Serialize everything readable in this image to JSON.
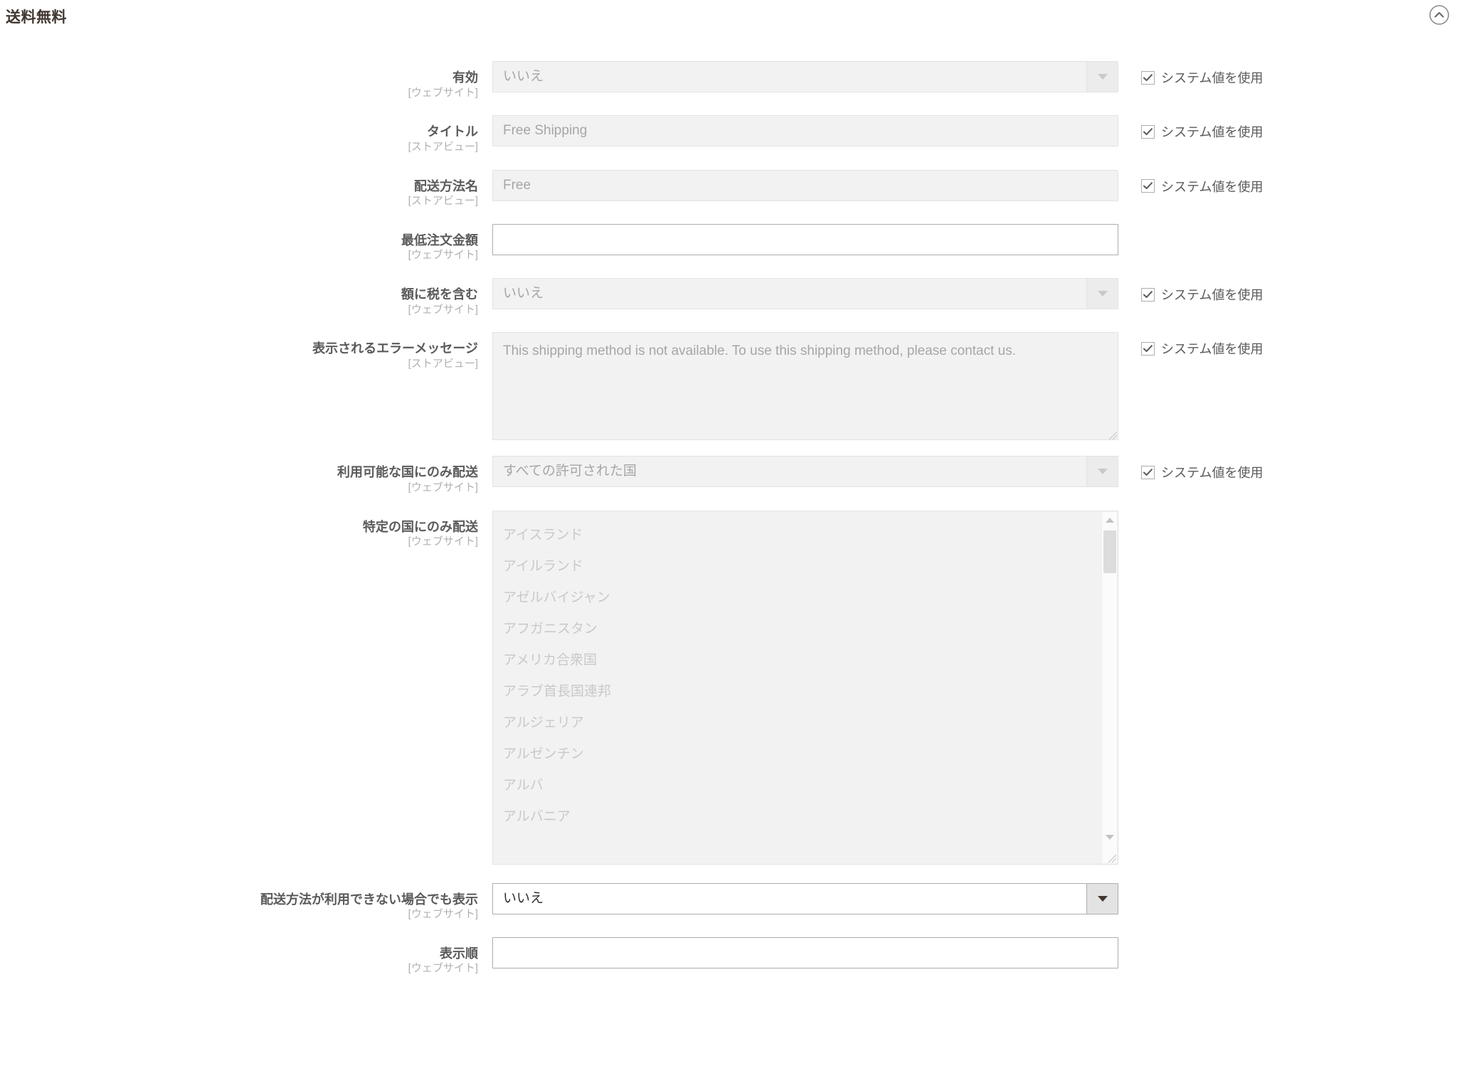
{
  "section": {
    "title": "送料無料",
    "collapse_icon": "chevron-up-circle-icon"
  },
  "use_system_value_label": "システム値を使用",
  "scope": {
    "website": "[ウェブサイト]",
    "storeview": "[ストアビュー]"
  },
  "fields": [
    {
      "id": "active",
      "label": "有効",
      "scope": "[ウェブサイト]",
      "type": "select",
      "value": "いいえ",
      "disabled": true,
      "use_system_value": true
    },
    {
      "id": "title",
      "label": "タイトル",
      "scope": "[ストアビュー]",
      "type": "text",
      "value": "Free Shipping",
      "disabled": true,
      "use_system_value": true
    },
    {
      "id": "method-name",
      "label": "配送方法名",
      "scope": "[ストアビュー]",
      "type": "text",
      "value": "Free",
      "disabled": true,
      "use_system_value": true
    },
    {
      "id": "minimum-order-amount",
      "label": "最低注文金額",
      "scope": "[ウェブサイト]",
      "type": "text",
      "value": "",
      "disabled": false,
      "use_system_value": false
    },
    {
      "id": "include-tax-in-amount",
      "label": "額に税を含む",
      "scope": "[ウェブサイト]",
      "type": "select",
      "value": "いいえ",
      "disabled": true,
      "use_system_value": true
    },
    {
      "id": "error-message",
      "label": "表示されるエラーメッセージ",
      "scope": "[ストアビュー]",
      "type": "textarea",
      "value": "This shipping method is not available. To use this shipping method, please contact us.",
      "disabled": true,
      "use_system_value": true
    },
    {
      "id": "ship-to-applicable-countries",
      "label": "利用可能な国にのみ配送",
      "scope": "[ウェブサイト]",
      "type": "select",
      "value": "すべての許可された国",
      "disabled": true,
      "use_system_value": true
    },
    {
      "id": "ship-to-specific-countries",
      "label": "特定の国にのみ配送",
      "scope": "[ウェブサイト]",
      "type": "multiselect",
      "options": [
        "アイスランド",
        "アイルランド",
        "アゼルバイジャン",
        "アフガニスタン",
        "アメリカ合衆国",
        "アラブ首長国連邦",
        "アルジェリア",
        "アルゼンチン",
        "アルバ",
        "アルバニア"
      ],
      "disabled": true,
      "use_system_value": false
    },
    {
      "id": "show-method-if-not-applicable",
      "label": "配送方法が利用できない場合でも表示",
      "scope": "[ウェブサイト]",
      "type": "select",
      "value": "いいえ",
      "disabled": false,
      "use_system_value": false
    },
    {
      "id": "sort-order",
      "label": "表示順",
      "scope": "[ウェブサイト]",
      "type": "text",
      "value": "",
      "disabled": false,
      "use_system_value": false
    }
  ]
}
